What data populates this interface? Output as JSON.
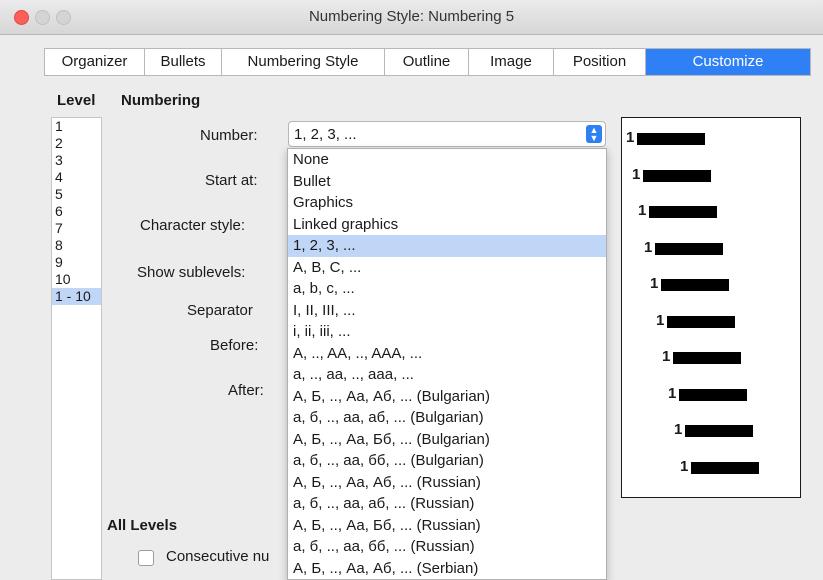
{
  "window": {
    "title": "Numbering Style: Numbering 5"
  },
  "tabs": [
    {
      "label": "Organizer"
    },
    {
      "label": "Bullets"
    },
    {
      "label": "Numbering Style"
    },
    {
      "label": "Outline"
    },
    {
      "label": "Image"
    },
    {
      "label": "Position"
    },
    {
      "label": "Customize"
    }
  ],
  "active_tab": "Customize",
  "level": {
    "heading": "Level",
    "items": [
      "1",
      "2",
      "3",
      "4",
      "5",
      "6",
      "7",
      "8",
      "9",
      "10",
      "1 - 10"
    ],
    "selected": "1 - 10"
  },
  "numbering": {
    "heading": "Numbering",
    "number_label": "Number:",
    "number_value": "1, 2, 3, ...",
    "start_label": "Start at:",
    "char_style_label": "Character style:",
    "sublevels_label": "Show sublevels:",
    "separator_label": "Separator",
    "before_label": "Before:",
    "after_label": "After:"
  },
  "dropdown": {
    "options": [
      "None",
      "Bullet",
      "Graphics",
      "Linked graphics",
      "1, 2, 3, ...",
      "A, B, C, ...",
      "a, b, c, ...",
      "I, II, III, ...",
      "i, ii, iii, ...",
      "A, .., AA, .., AAA, ...",
      "a, .., aa, .., aaa, ...",
      "А, Б, .., Аа, Аб, ... (Bulgarian)",
      "а, б, .., аа, аб, ... (Bulgarian)",
      "А, Б, .., Аа, Бб, ... (Bulgarian)",
      "а, б, .., аа, бб, ... (Bulgarian)",
      "А, Б, .., Аа, Аб, ... (Russian)",
      "а, б, .., аа, аб, ... (Russian)",
      "А, Б, .., Аа, Бб, ... (Russian)",
      "а, б, .., аа, бб, ... (Russian)",
      "А, Б, .., Аа, Аб, ... (Serbian)"
    ],
    "selected": "1, 2, 3, ..."
  },
  "preview": {
    "number": "1",
    "rows": 10
  },
  "all_levels": {
    "heading": "All Levels",
    "consecutive_label": "Consecutive nu"
  },
  "colors": {
    "accent": "#2f80f5",
    "selection": "#bfd6f6"
  }
}
